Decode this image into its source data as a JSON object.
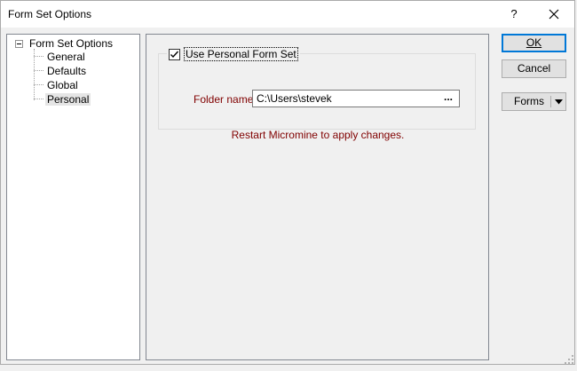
{
  "window": {
    "title": "Form Set Options",
    "help_glyph": "?",
    "close_glyph": "✕"
  },
  "tree": {
    "root_label": "Form Set Options",
    "items": [
      {
        "label": "General",
        "selected": false
      },
      {
        "label": "Defaults",
        "selected": false
      },
      {
        "label": "Global",
        "selected": false
      },
      {
        "label": "Personal",
        "selected": true
      }
    ]
  },
  "personal": {
    "use_personal_label": "Use Personal Form Set",
    "use_personal_checked": true,
    "folder_label": "Folder name",
    "folder_value": "C:\\Users\\stevek",
    "browse_label": "...",
    "restart_message": "Restart Micromine to apply changes."
  },
  "buttons": {
    "ok_label": "OK",
    "cancel_label": "Cancel",
    "forms_label": "Forms"
  },
  "colors": {
    "accent": "#0078d7",
    "label_red": "#800000"
  }
}
